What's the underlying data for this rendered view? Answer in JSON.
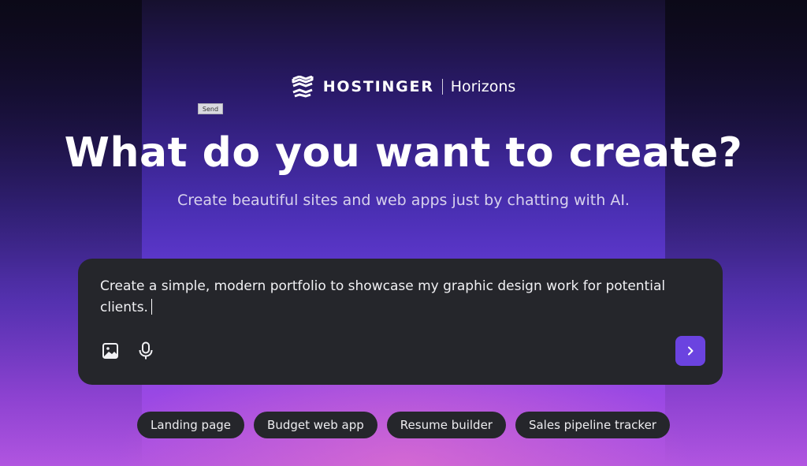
{
  "brand": {
    "name": "HOSTINGER",
    "product": "Horizons",
    "icon": "hostinger-wave-logo-icon"
  },
  "tooltip": {
    "text": "Send"
  },
  "hero": {
    "title": "What do you want to create?",
    "subtitle": "Create beautiful sites and web apps just by chatting with AI."
  },
  "composer": {
    "value": "Create a simple, modern portfolio to showcase my graphic design work for potential clients.",
    "tools": [
      {
        "icon": "image-icon"
      },
      {
        "icon": "microphone-icon"
      }
    ],
    "send_icon": "chevron-right-icon"
  },
  "suggestions": [
    {
      "label": "Landing page"
    },
    {
      "label": "Budget web app"
    },
    {
      "label": "Resume builder"
    },
    {
      "label": "Sales pipeline tracker"
    }
  ],
  "colors": {
    "accent": "#6b43e0",
    "panel": "#25262b",
    "text": "#ffffff"
  }
}
